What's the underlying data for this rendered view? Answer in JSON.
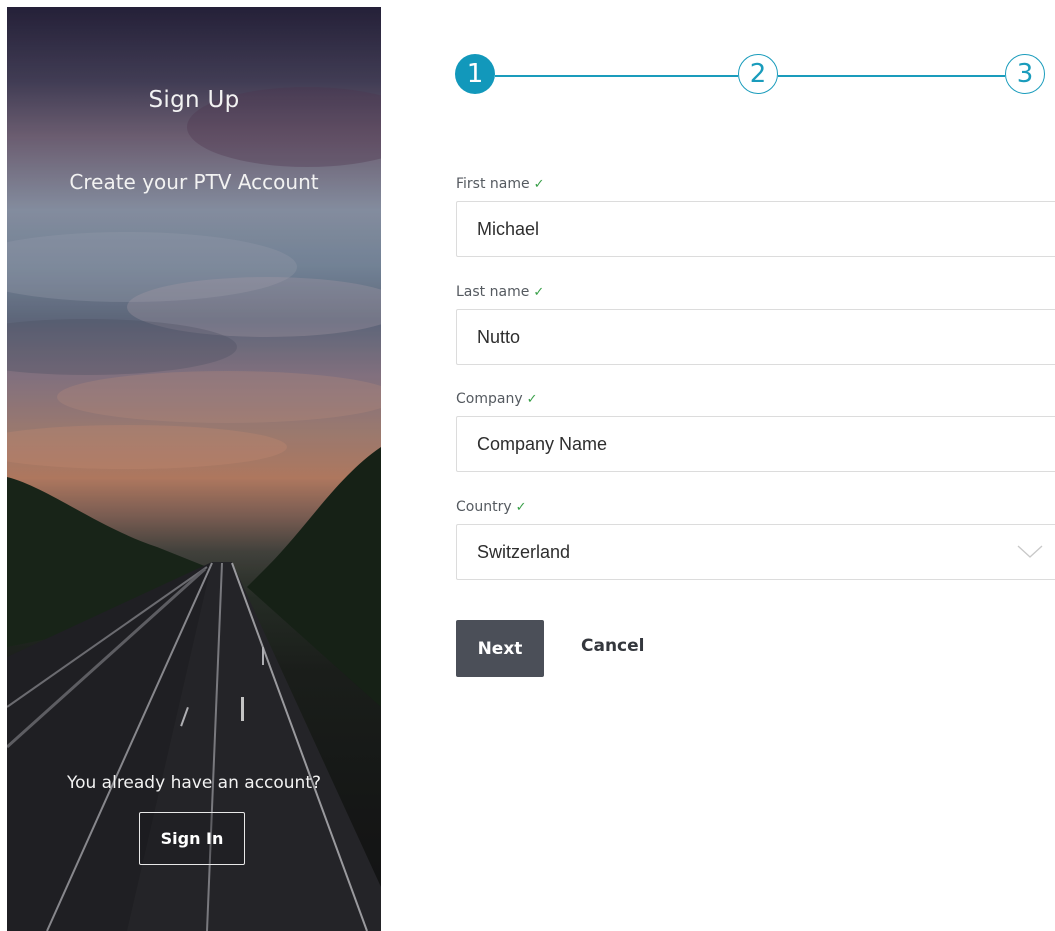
{
  "hero": {
    "title": "Sign Up",
    "subtitle": "Create your PTV Account",
    "question": "You already have an account?",
    "signin_label": "Sign In"
  },
  "stepper": {
    "steps": [
      {
        "label": "1",
        "state": "active"
      },
      {
        "label": "2",
        "state": "inactive"
      },
      {
        "label": "3",
        "state": "inactive"
      }
    ],
    "accent_color": "#1a9cbc"
  },
  "form": {
    "first_name": {
      "label": "First name",
      "value": "Michael",
      "check_icon": "check-icon"
    },
    "last_name": {
      "label": "Last name",
      "value": "Nutto",
      "check_icon": "check-icon"
    },
    "company": {
      "label": "Company",
      "value": "Company Name",
      "check_icon": "check-icon"
    },
    "country": {
      "label": "Country",
      "value": "Switzerland",
      "check_icon": "check-icon"
    },
    "next_label": "Next",
    "cancel_label": "Cancel",
    "check_glyph": "✓",
    "valid_color": "#3aa04a",
    "button_color": "#4b4f58"
  }
}
